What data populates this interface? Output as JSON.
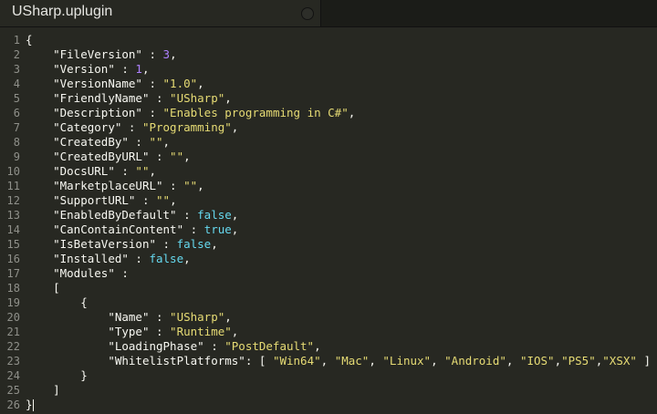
{
  "tab": {
    "title": "USharp.uplugin"
  },
  "colors": {
    "background": "#272822",
    "text": "#f8f8f2",
    "string": "#e6db74",
    "number": "#ae81ff",
    "keyword": "#66d9ef",
    "line_number": "#8f908a"
  },
  "lines": [
    "{",
    "    \"FileVersion\" : 3,",
    "    \"Version\" : 1,",
    "    \"VersionName\" : \"1.0\",",
    "    \"FriendlyName\" : \"USharp\",",
    "    \"Description\" : \"Enables programming in C#\",",
    "    \"Category\" : \"Programming\",",
    "    \"CreatedBy\" : \"\",",
    "    \"CreatedByURL\" : \"\",",
    "    \"DocsURL\" : \"\",",
    "    \"MarketplaceURL\" : \"\",",
    "    \"SupportURL\" : \"\",",
    "    \"EnabledByDefault\" : false,",
    "    \"CanContainContent\" : true,",
    "    \"IsBetaVersion\" : false,",
    "    \"Installed\" : false,",
    "    \"Modules\" :",
    "    [",
    "        {",
    "            \"Name\" : \"USharp\",",
    "            \"Type\" : \"Runtime\",",
    "            \"LoadingPhase\" : \"PostDefault\",",
    "            \"WhitelistPlatforms\": [ \"Win64\", \"Mac\", \"Linux\", \"Android\", \"IOS\",\"PS5\",\"XSX\" ]",
    "        }",
    "    ]",
    "}"
  ]
}
